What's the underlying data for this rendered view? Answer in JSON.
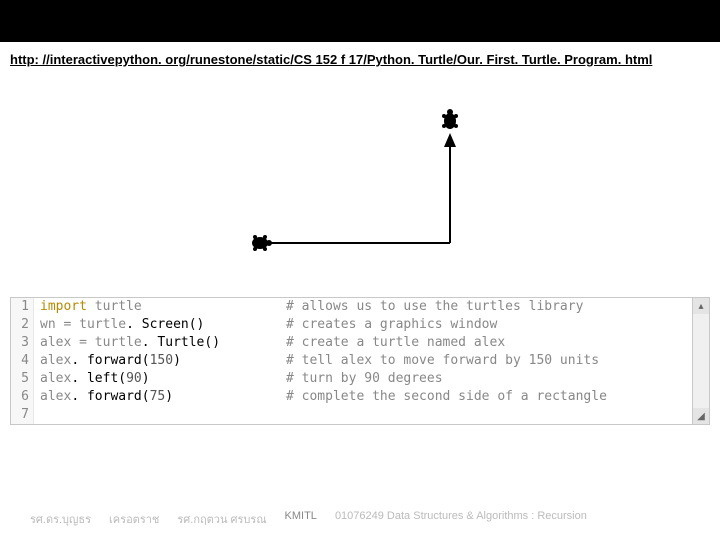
{
  "url": "http: //interactivepython. org/runestone/static/CS 152 f 17/Python. Turtle/Our. First. Turtle. Program. html",
  "code": {
    "lines": [
      {
        "n": "1",
        "text": "import turtle",
        "comment": "# allows us to use the turtles library"
      },
      {
        "n": "2",
        "text": "wn = turtle. Screen()",
        "comment": "# creates a graphics window"
      },
      {
        "n": "3",
        "text": "alex = turtle. Turtle()",
        "comment": "# create a turtle named alex"
      },
      {
        "n": "4",
        "text": "alex. forward(150)",
        "comment": "# tell alex to move forward by 150 units"
      },
      {
        "n": "5",
        "text": "alex. left(90)",
        "comment": "# turn by 90 degrees"
      },
      {
        "n": "6",
        "text": "alex. forward(75)",
        "comment": "# complete the second side of a rectangle"
      },
      {
        "n": "7",
        "text": "",
        "comment": ""
      }
    ]
  },
  "footer": {
    "a": "รศ.ดร.บุญธร",
    "b": "เครอตราช",
    "c": "รศ.กฤตวน ศรบรณ",
    "d": "KMITL",
    "e": "01076249 Data Structures & Algorithms : Recursion"
  }
}
